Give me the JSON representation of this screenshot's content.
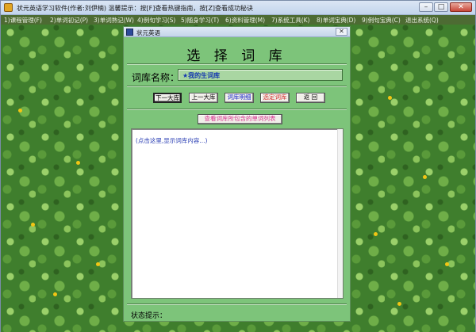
{
  "window": {
    "title": "状元英语学习软件(作者:刘伊楠)   温馨提示：按[F]查看热键指南，按[Z]查看成功秘诀",
    "min_glyph": "–",
    "max_glyph": "□",
    "close_glyph": "✕"
  },
  "menu": [
    "1)课程管理(F)",
    "2)单词初记(P)",
    "3)单词熟记(W)",
    "4)例句学习(S)",
    "5)随身学习(T)",
    "6)资料管理(M)",
    "7)系统工具(K)",
    "8)单词宝典(D)",
    "9)例句宝典(C)",
    "退出系统(Q)"
  ],
  "dialog": {
    "title": "状元英语",
    "close_glyph": "✕",
    "heading": "选 择 词 库",
    "library_label": "词库名称：",
    "library_value": "★我的生词库",
    "buttons": {
      "next": "下一大库",
      "prev": "上一大库",
      "details": "词库明细",
      "select": "选定词库",
      "back": "返 回"
    },
    "list_button": "查看词库所包含的单词列表",
    "content_hint": "(点击这里,显示词库内容...)",
    "status_label": "状态提示："
  },
  "colors": {
    "dialog_bg": "#7dc47a",
    "menubar_bg": "#4d6b33",
    "details_text": "#1b27c8",
    "select_text": "#d42d2d",
    "list_text": "#d8338f",
    "hint_text": "#2b3fb4"
  }
}
